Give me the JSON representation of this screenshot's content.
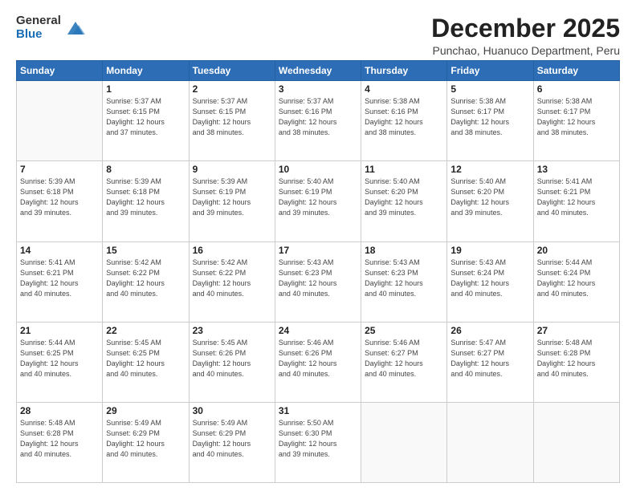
{
  "logo": {
    "general": "General",
    "blue": "Blue"
  },
  "header": {
    "title": "December 2025",
    "subtitle": "Punchao, Huanuco Department, Peru"
  },
  "days_of_week": [
    "Sunday",
    "Monday",
    "Tuesday",
    "Wednesday",
    "Thursday",
    "Friday",
    "Saturday"
  ],
  "weeks": [
    [
      {
        "day": "",
        "info": ""
      },
      {
        "day": "1",
        "info": "Sunrise: 5:37 AM\nSunset: 6:15 PM\nDaylight: 12 hours\nand 37 minutes."
      },
      {
        "day": "2",
        "info": "Sunrise: 5:37 AM\nSunset: 6:15 PM\nDaylight: 12 hours\nand 38 minutes."
      },
      {
        "day": "3",
        "info": "Sunrise: 5:37 AM\nSunset: 6:16 PM\nDaylight: 12 hours\nand 38 minutes."
      },
      {
        "day": "4",
        "info": "Sunrise: 5:38 AM\nSunset: 6:16 PM\nDaylight: 12 hours\nand 38 minutes."
      },
      {
        "day": "5",
        "info": "Sunrise: 5:38 AM\nSunset: 6:17 PM\nDaylight: 12 hours\nand 38 minutes."
      },
      {
        "day": "6",
        "info": "Sunrise: 5:38 AM\nSunset: 6:17 PM\nDaylight: 12 hours\nand 38 minutes."
      }
    ],
    [
      {
        "day": "7",
        "info": "Sunrise: 5:39 AM\nSunset: 6:18 PM\nDaylight: 12 hours\nand 39 minutes."
      },
      {
        "day": "8",
        "info": "Sunrise: 5:39 AM\nSunset: 6:18 PM\nDaylight: 12 hours\nand 39 minutes."
      },
      {
        "day": "9",
        "info": "Sunrise: 5:39 AM\nSunset: 6:19 PM\nDaylight: 12 hours\nand 39 minutes."
      },
      {
        "day": "10",
        "info": "Sunrise: 5:40 AM\nSunset: 6:19 PM\nDaylight: 12 hours\nand 39 minutes."
      },
      {
        "day": "11",
        "info": "Sunrise: 5:40 AM\nSunset: 6:20 PM\nDaylight: 12 hours\nand 39 minutes."
      },
      {
        "day": "12",
        "info": "Sunrise: 5:40 AM\nSunset: 6:20 PM\nDaylight: 12 hours\nand 39 minutes."
      },
      {
        "day": "13",
        "info": "Sunrise: 5:41 AM\nSunset: 6:21 PM\nDaylight: 12 hours\nand 40 minutes."
      }
    ],
    [
      {
        "day": "14",
        "info": "Sunrise: 5:41 AM\nSunset: 6:21 PM\nDaylight: 12 hours\nand 40 minutes."
      },
      {
        "day": "15",
        "info": "Sunrise: 5:42 AM\nSunset: 6:22 PM\nDaylight: 12 hours\nand 40 minutes."
      },
      {
        "day": "16",
        "info": "Sunrise: 5:42 AM\nSunset: 6:22 PM\nDaylight: 12 hours\nand 40 minutes."
      },
      {
        "day": "17",
        "info": "Sunrise: 5:43 AM\nSunset: 6:23 PM\nDaylight: 12 hours\nand 40 minutes."
      },
      {
        "day": "18",
        "info": "Sunrise: 5:43 AM\nSunset: 6:23 PM\nDaylight: 12 hours\nand 40 minutes."
      },
      {
        "day": "19",
        "info": "Sunrise: 5:43 AM\nSunset: 6:24 PM\nDaylight: 12 hours\nand 40 minutes."
      },
      {
        "day": "20",
        "info": "Sunrise: 5:44 AM\nSunset: 6:24 PM\nDaylight: 12 hours\nand 40 minutes."
      }
    ],
    [
      {
        "day": "21",
        "info": "Sunrise: 5:44 AM\nSunset: 6:25 PM\nDaylight: 12 hours\nand 40 minutes."
      },
      {
        "day": "22",
        "info": "Sunrise: 5:45 AM\nSunset: 6:25 PM\nDaylight: 12 hours\nand 40 minutes."
      },
      {
        "day": "23",
        "info": "Sunrise: 5:45 AM\nSunset: 6:26 PM\nDaylight: 12 hours\nand 40 minutes."
      },
      {
        "day": "24",
        "info": "Sunrise: 5:46 AM\nSunset: 6:26 PM\nDaylight: 12 hours\nand 40 minutes."
      },
      {
        "day": "25",
        "info": "Sunrise: 5:46 AM\nSunset: 6:27 PM\nDaylight: 12 hours\nand 40 minutes."
      },
      {
        "day": "26",
        "info": "Sunrise: 5:47 AM\nSunset: 6:27 PM\nDaylight: 12 hours\nand 40 minutes."
      },
      {
        "day": "27",
        "info": "Sunrise: 5:48 AM\nSunset: 6:28 PM\nDaylight: 12 hours\nand 40 minutes."
      }
    ],
    [
      {
        "day": "28",
        "info": "Sunrise: 5:48 AM\nSunset: 6:28 PM\nDaylight: 12 hours\nand 40 minutes."
      },
      {
        "day": "29",
        "info": "Sunrise: 5:49 AM\nSunset: 6:29 PM\nDaylight: 12 hours\nand 40 minutes."
      },
      {
        "day": "30",
        "info": "Sunrise: 5:49 AM\nSunset: 6:29 PM\nDaylight: 12 hours\nand 40 minutes."
      },
      {
        "day": "31",
        "info": "Sunrise: 5:50 AM\nSunset: 6:30 PM\nDaylight: 12 hours\nand 39 minutes."
      },
      {
        "day": "",
        "info": ""
      },
      {
        "day": "",
        "info": ""
      },
      {
        "day": "",
        "info": ""
      }
    ]
  ]
}
